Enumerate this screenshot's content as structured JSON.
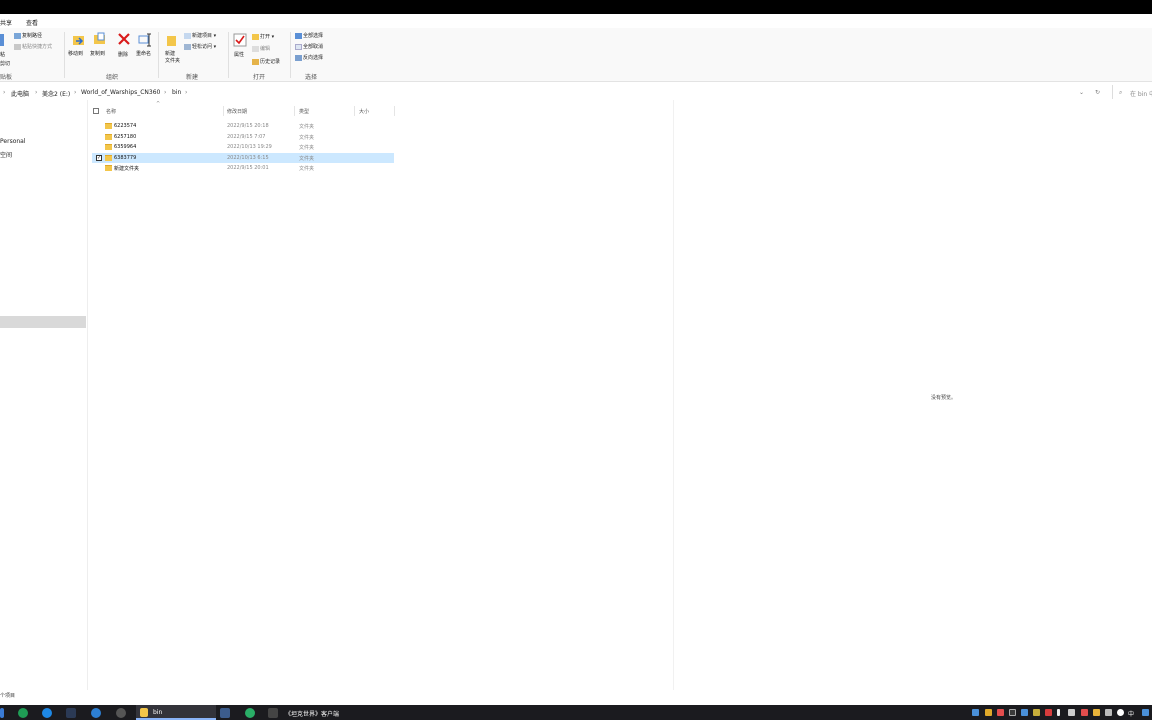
{
  "window": {
    "current_folder": "bin"
  },
  "menu_tabs": [
    "共享",
    "查看"
  ],
  "ribbon": {
    "clipboard": {
      "copy_path": "复制路径",
      "paste_shortcut": "粘贴快捷方式",
      "cut": "剪切",
      "paste_fragment": "粘",
      "group_label": "贴板"
    },
    "organize": {
      "move_to": "移动到",
      "copy_to": "复制到",
      "delete": "删除",
      "rename": "重命名",
      "group_label": "组织"
    },
    "new": {
      "new_folder_line1": "新建",
      "new_folder_line2": "文件夹",
      "new_item": "新建项目 ▾",
      "easy_access": "轻松访问 ▾",
      "group_label": "新建"
    },
    "open": {
      "properties": "属性",
      "open": "打开 ▾",
      "edit": "编辑",
      "history": "历史记录",
      "group_label": "打开"
    },
    "select": {
      "select_all": "全部选择",
      "select_none": "全部取消",
      "invert": "反向选择",
      "group_label": "选择"
    }
  },
  "address": {
    "crumbs": [
      "此电脑",
      "美念2 (E:)",
      "World_of_Warships_CN360",
      "bin"
    ],
    "search_placeholder": "在 bin 中"
  },
  "nav": {
    "item_personal": "Personal",
    "item_space": "空间"
  },
  "columns": {
    "name": "名称",
    "date": "修改日期",
    "type": "类型",
    "size": "大小"
  },
  "files": [
    {
      "name": "6223574",
      "date": "2022/9/15 20:18",
      "type": "文件夹",
      "selected": false
    },
    {
      "name": "6257180",
      "date": "2022/9/15 7:07",
      "type": "文件夹",
      "selected": false
    },
    {
      "name": "6359964",
      "date": "2022/10/13 19:29",
      "type": "文件夹",
      "selected": false
    },
    {
      "name": "6383779",
      "date": "2022/10/13 6:15",
      "type": "文件夹",
      "selected": true
    },
    {
      "name": "新建文件夹",
      "date": "2022/9/15 20:01",
      "type": "文件夹",
      "selected": false
    }
  ],
  "preview": {
    "empty_text": "没有预览。"
  },
  "status": {
    "count_text": "个项目"
  },
  "taskbar": {
    "explorer_label": "bin",
    "game_label": "《坦克世界》客户端",
    "ime_label": "中"
  },
  "colors": {
    "selection": "#cce8ff",
    "folder": "#f3c64a",
    "taskbar": "#1b1b1f"
  }
}
